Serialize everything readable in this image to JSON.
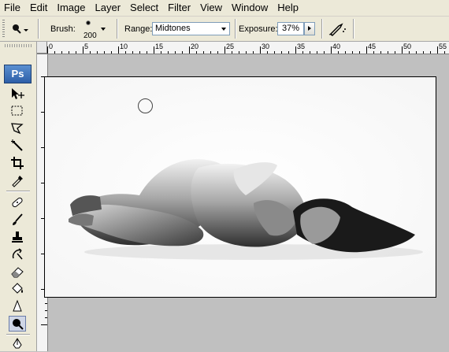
{
  "menu": [
    "File",
    "Edit",
    "Image",
    "Layer",
    "Select",
    "Filter",
    "View",
    "Window",
    "Help"
  ],
  "options": {
    "brush_label": "Brush:",
    "brush_size": "200",
    "range_label": "Range:",
    "range_value": "Midtones",
    "exposure_label": "Exposure:",
    "exposure_value": "37%"
  },
  "ruler": {
    "top_ticks": [
      "0",
      "5",
      "10",
      "15",
      "20",
      "25",
      "30",
      "35",
      "40",
      "45",
      "50",
      "55"
    ]
  },
  "toolbox": {
    "logo": "Ps",
    "active_tool": "burn-tool"
  },
  "colors": {
    "workspace": "#c0c0c0",
    "chrome": "#ece9d8"
  }
}
